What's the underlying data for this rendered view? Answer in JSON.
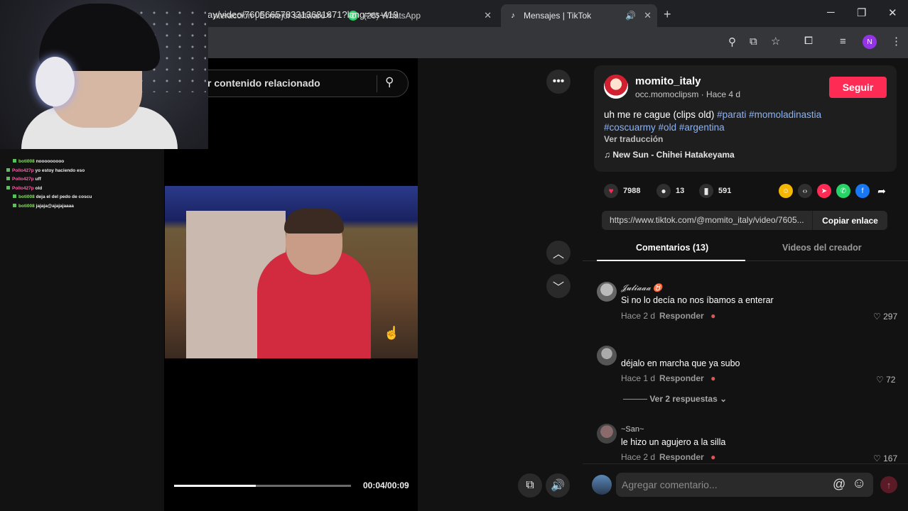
{
  "browser": {
    "tabs": [
      {
        "label": "nteracción | El mejor software",
        "close": "✕"
      },
      {
        "label": "(26) WhatsApp",
        "close": "✕"
      },
      {
        "label": "Mensajes | TikTok",
        "close": "✕"
      }
    ],
    "new_tab": "+",
    "url": "ay/video/7605665783313681671?lang=es-419",
    "profile_initial": "N",
    "window_controls": {
      "minimize": "─",
      "maximize": "❐",
      "close": "✕"
    }
  },
  "chat": {
    "messages": [
      {
        "user": "boti008",
        "text": "nooooooooo",
        "color": "#8be06a"
      },
      {
        "user": "Pollo427p",
        "text": "yo estoy haciendo eso",
        "color": "#ff5fa8"
      },
      {
        "user": "Pollo427p",
        "text": "uff",
        "color": "#ff5fa8"
      },
      {
        "user": "Pollo427p",
        "text": "old",
        "color": "#ff5fa8"
      },
      {
        "user": "boti008",
        "text": "deja el del pedo de coscu",
        "color": "#8be06a"
      },
      {
        "user": "boti008",
        "text": "jajaja@ajajajaaaa",
        "color": "#8be06a"
      }
    ]
  },
  "video": {
    "search_placeholder": "r contenido relacionado",
    "time": "00:04/00:09",
    "progress": 0.46
  },
  "post": {
    "author": "momito_italy",
    "subtitle": "occ.momoclipsm · Hace 4 d",
    "follow_label": "Seguir",
    "caption_text": "uh me re cague (clips old) ",
    "hashtags_line1": [
      "#parati",
      "#momoladinastia"
    ],
    "hashtags_line2": [
      "#coscuarmy",
      "#old",
      "#argentina"
    ],
    "translate_label": "Ver traducción",
    "music": "New Sun - Chihei Hatakeyama",
    "likes": "7988",
    "comments": "13",
    "saves": "591",
    "link": "https://www.tiktok.com/@momito_italy/video/7605...",
    "copy_label": "Copiar enlace"
  },
  "panel_tabs": {
    "comments": "Comentarios (13)",
    "creator": "Videos del creador"
  },
  "comments": [
    {
      "user": "𝓙𝓾𝓵𝓲𝓪𝓪𝓪 ♉",
      "text": "Si no lo decía no nos íbamos a enterar",
      "time": "Hace 2 d",
      "reply": "Responder",
      "likes": "297"
    },
    {
      "user": "",
      "text": "déjalo en marcha que ya subo",
      "time": "Hace 1 d",
      "reply": "Responder",
      "likes": "72"
    },
    {
      "user": "~San~",
      "text": "le hizo un agujero a la silla",
      "time": "Hace 2 d",
      "reply": "Responder",
      "likes": "167"
    }
  ],
  "more_replies": "Ver 2 respuestas",
  "composer": {
    "placeholder": "Agregar comentario...",
    "mention": "@",
    "emoji": "☺",
    "send": "↑"
  }
}
